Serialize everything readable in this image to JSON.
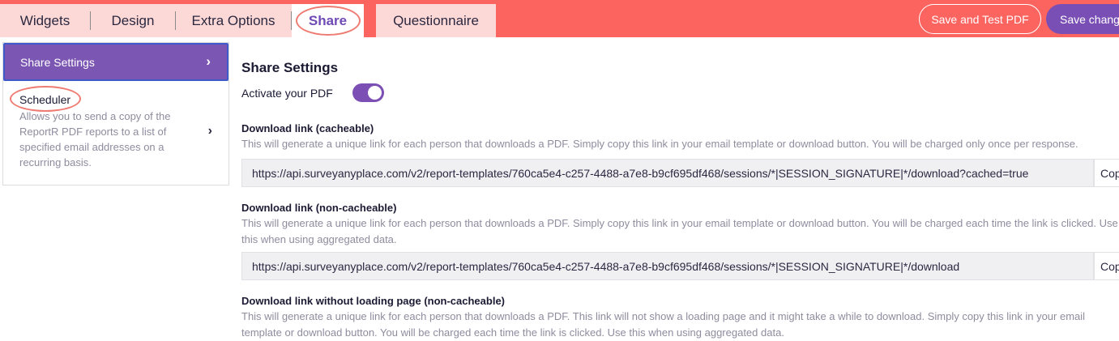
{
  "tabs": {
    "widgets": "Widgets",
    "design": "Design",
    "extra_options": "Extra Options",
    "share": "Share",
    "questionnaire": "Questionnaire"
  },
  "actions": {
    "save_and_test": "Save and Test PDF",
    "save_changes": "Save changes"
  },
  "sidebar": {
    "share_settings": "Share Settings",
    "scheduler_title": "Scheduler",
    "scheduler_desc": "Allows you to send a copy of the ReportR PDF reports to a list of specified email addresses on a recurring basis.",
    "chevron": "›"
  },
  "main": {
    "title": "Share Settings",
    "activate_label": "Activate your PDF",
    "activate_on": true,
    "cacheable": {
      "label": "Download link (cacheable)",
      "help": "This will generate a unique link for each person that downloads a PDF. Simply copy this link in your email template or download button. You will be charged only once per response.",
      "url": "https://api.surveyanyplace.com/v2/report-templates/760ca5e4-c257-4488-a7e8-b9cf695df468/sessions/*|SESSION_SIGNATURE|*/download?cached=true",
      "copy": "Copy"
    },
    "non_cacheable": {
      "label": "Download link (non-cacheable)",
      "help": "This will generate a unique link for each person that downloads a PDF. Simply copy this link in your email template or download button. You will be charged each time the link is clicked. Use this when using aggregated data.",
      "url": "https://api.surveyanyplace.com/v2/report-templates/760ca5e4-c257-4488-a7e8-b9cf695df468/sessions/*|SESSION_SIGNATURE|*/download",
      "copy": "Copy"
    },
    "no_loading": {
      "label": "Download link without loading page (non-cacheable)",
      "help": "This will generate a unique link for each person that downloads a PDF. This link will not show a loading page and it might take a while to download. Simply copy this link in your email template or download button. You will be charged each time the link is clicked. Use this when using aggregated data."
    }
  },
  "colors": {
    "topbar": "#fc6460",
    "tab_inactive": "#fcd9d7",
    "accent_purple": "#7c56b3",
    "highlight_ring": "#ef7c73"
  }
}
